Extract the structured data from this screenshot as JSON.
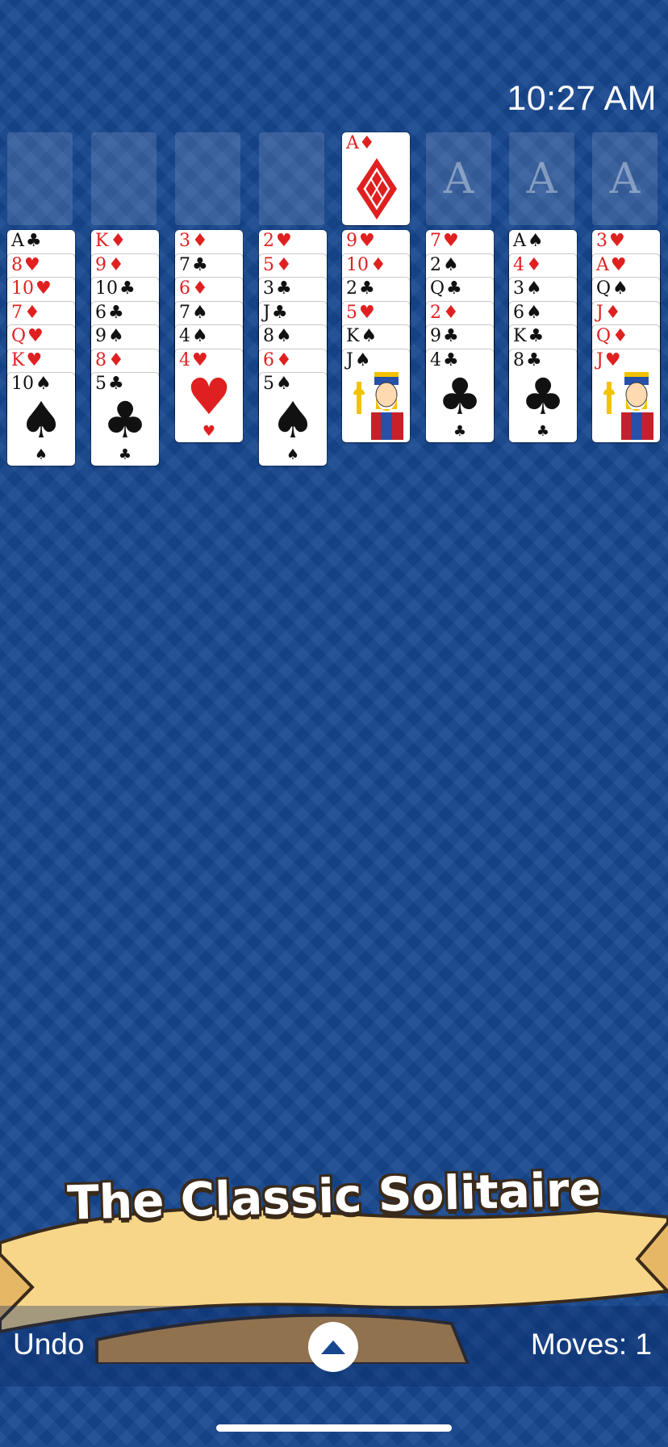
{
  "status": {
    "time": "10:27 AM"
  },
  "free_cells": [
    "",
    "",
    "",
    ""
  ],
  "foundations": [
    {
      "label": "A",
      "suit": "♦",
      "color": "red",
      "filled": true
    },
    {
      "label": "A",
      "filled": false
    },
    {
      "label": "A",
      "filled": false
    },
    {
      "label": "A",
      "filled": false
    }
  ],
  "columns": [
    [
      {
        "rank": "A",
        "suit": "♣"
      },
      {
        "rank": "8",
        "suit": "♥"
      },
      {
        "rank": "10",
        "suit": "♥"
      },
      {
        "rank": "7",
        "suit": "♦"
      },
      {
        "rank": "Q",
        "suit": "♥"
      },
      {
        "rank": "K",
        "suit": "♥"
      },
      {
        "rank": "10",
        "suit": "♠"
      }
    ],
    [
      {
        "rank": "K",
        "suit": "♦"
      },
      {
        "rank": "9",
        "suit": "♦"
      },
      {
        "rank": "10",
        "suit": "♣"
      },
      {
        "rank": "6",
        "suit": "♣"
      },
      {
        "rank": "9",
        "suit": "♠"
      },
      {
        "rank": "8",
        "suit": "♦"
      },
      {
        "rank": "5",
        "suit": "♣"
      }
    ],
    [
      {
        "rank": "3",
        "suit": "♦"
      },
      {
        "rank": "7",
        "suit": "♣"
      },
      {
        "rank": "6",
        "suit": "♦"
      },
      {
        "rank": "7",
        "suit": "♠"
      },
      {
        "rank": "4",
        "suit": "♠"
      },
      {
        "rank": "4",
        "suit": "♥"
      }
    ],
    [
      {
        "rank": "2",
        "suit": "♥"
      },
      {
        "rank": "5",
        "suit": "♦"
      },
      {
        "rank": "3",
        "suit": "♣"
      },
      {
        "rank": "J",
        "suit": "♣"
      },
      {
        "rank": "8",
        "suit": "♠"
      },
      {
        "rank": "6",
        "suit": "♦"
      },
      {
        "rank": "5",
        "suit": "♠"
      }
    ],
    [
      {
        "rank": "9",
        "suit": "♥"
      },
      {
        "rank": "10",
        "suit": "♦"
      },
      {
        "rank": "2",
        "suit": "♣"
      },
      {
        "rank": "5",
        "suit": "♥"
      },
      {
        "rank": "K",
        "suit": "♠"
      },
      {
        "rank": "J",
        "suit": "♠"
      }
    ],
    [
      {
        "rank": "7",
        "suit": "♥"
      },
      {
        "rank": "2",
        "suit": "♠"
      },
      {
        "rank": "Q",
        "suit": "♣"
      },
      {
        "rank": "2",
        "suit": "♦"
      },
      {
        "rank": "9",
        "suit": "♣"
      },
      {
        "rank": "4",
        "suit": "♣"
      }
    ],
    [
      {
        "rank": "A",
        "suit": "♠"
      },
      {
        "rank": "4",
        "suit": "♦"
      },
      {
        "rank": "3",
        "suit": "♠"
      },
      {
        "rank": "6",
        "suit": "♠"
      },
      {
        "rank": "K",
        "suit": "♣"
      },
      {
        "rank": "8",
        "suit": "♣"
      }
    ],
    [
      {
        "rank": "3",
        "suit": "♥"
      },
      {
        "rank": "A",
        "suit": "♥"
      },
      {
        "rank": "Q",
        "suit": "♠"
      },
      {
        "rank": "J",
        "suit": "♦"
      },
      {
        "rank": "Q",
        "suit": "♦"
      },
      {
        "rank": "J",
        "suit": "♥"
      }
    ]
  ],
  "banner": {
    "title": "The Classic Solitaire"
  },
  "bottom_bar": {
    "undo_label": "Undo",
    "moves_label": "Moves: 1",
    "menu_icon": "chevron-up-icon"
  },
  "colors": {
    "felt": "#17468e",
    "red_suit": "#e02020",
    "black_suit": "#111111",
    "banner_parchment": "#f7d68a"
  }
}
